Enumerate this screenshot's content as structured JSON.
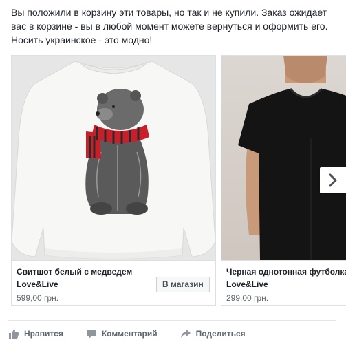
{
  "post": {
    "text_lines": [
      "Вы положили в корзину эти товары, но так и не купили. Заказ ожидает",
      "вас в корзине - вы в любой момент можете вернуться и оформить его.",
      "Носить украинское - это модно!"
    ]
  },
  "carousel": {
    "cards": [
      {
        "title": "Свитшот белый с медведем",
        "brand": "Love&Live",
        "price": "599,00 грн.",
        "button_label": "В магазин",
        "image_icon": "white-sweatshirt-bear-print"
      },
      {
        "title": "Черная однотонная футболка",
        "brand": "Love&Live",
        "price": "299,00 грн.",
        "image_icon": "black-tshirt-model"
      }
    ],
    "next_icon": "chevron-right-icon"
  },
  "actions": {
    "like": {
      "label": "Нравится",
      "icon": "thumbs-up-icon"
    },
    "comment": {
      "label": "Комментарий",
      "icon": "comment-icon"
    },
    "share": {
      "label": "Поделиться",
      "icon": "share-icon"
    }
  },
  "colors": {
    "text": "#1d2129",
    "secondary_text": "#606770",
    "border": "#dddfe2",
    "scarf_red": "#c8202a"
  }
}
